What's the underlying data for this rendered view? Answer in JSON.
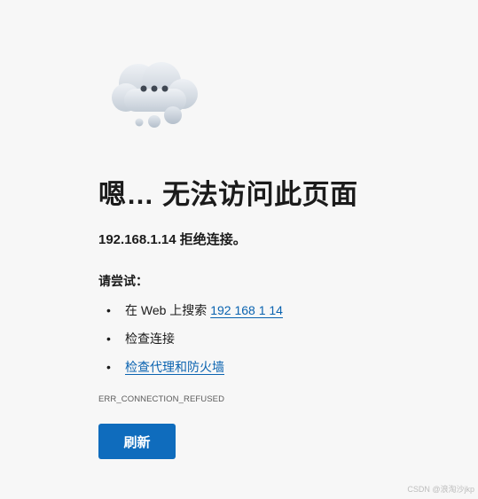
{
  "error_page": {
    "title": "嗯… 无法访问此页面",
    "subtitle": "192.168.1.14 拒绝连接。",
    "try_heading": "请尝试：",
    "suggestions": [
      {
        "prefix": "在 Web 上搜索 ",
        "link": "192 168 1 14"
      },
      {
        "text": "检查连接"
      },
      {
        "link": "检查代理和防火墙"
      }
    ],
    "bullet": "•",
    "error_code": "ERR_CONNECTION_REFUSED",
    "refresh_label": "刷新",
    "illustration_icon": "cloud-dots-icon"
  },
  "watermark": "CSDN @浪淘沙jkp",
  "colors": {
    "background": "#f7f7f7",
    "accent": "#0f6cbd",
    "link": "#0a63b0",
    "text": "#1b1b1b"
  }
}
